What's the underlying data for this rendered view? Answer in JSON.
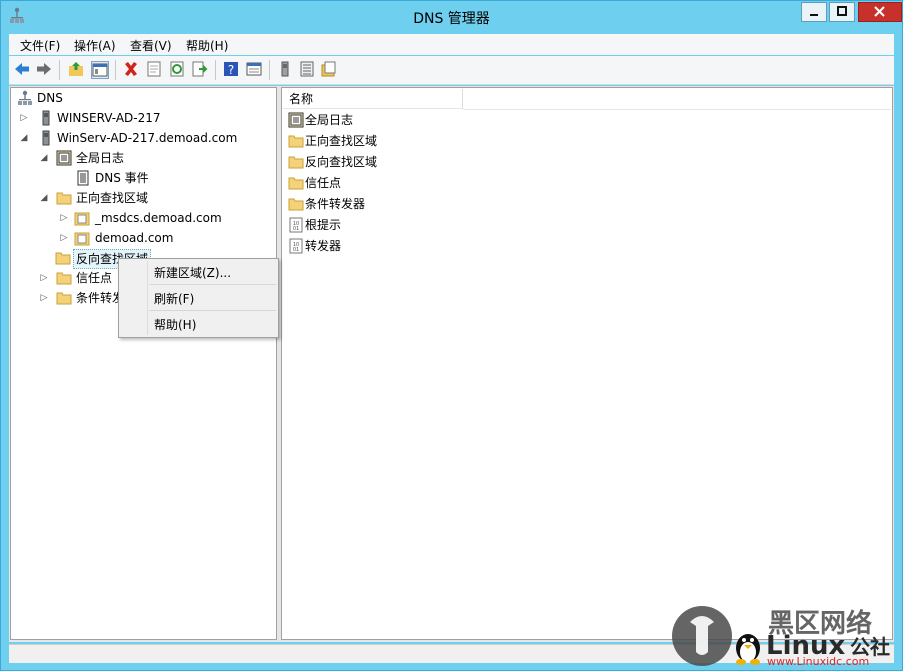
{
  "window": {
    "title": "DNS 管理器"
  },
  "menubar": {
    "items": [
      "文件(F)",
      "操作(A)",
      "查看(V)",
      "帮助(H)"
    ]
  },
  "toolbar": {
    "buttons": [
      "back-arrow-icon",
      "forward-arrow-icon",
      "up-folder-icon",
      "show-hide-tree-icon",
      "delete-icon",
      "properties-icon",
      "refresh-icon",
      "export-icon",
      "help-icon",
      "view-icon",
      "server-icon",
      "list-icon",
      "zones-icon"
    ]
  },
  "tree": {
    "root": "DNS",
    "servers": [
      {
        "label": "WINSERV-AD-217"
      },
      {
        "label": "WinServ-AD-217.demoad.com"
      }
    ],
    "global_logs": "全局日志",
    "dns_events": "DNS 事件",
    "forward_zones": "正向查找区域",
    "msdcs": "_msdcs.demoad.com",
    "demoad": "demoad.com",
    "reverse_zones": "反向查找区域",
    "trust_points": "信任点",
    "conditional_forwarders": "条件转发器"
  },
  "list": {
    "column_name": "名称",
    "items": [
      "全局日志",
      "正向查找区域",
      "反向查找区域",
      "信任点",
      "条件转发器",
      "根提示",
      "转发器"
    ]
  },
  "context_menu": {
    "items": [
      "新建区域(Z)...",
      "刷新(F)",
      "帮助(H)"
    ]
  },
  "watermark": {
    "brand": "黑区网络",
    "logo": "Linux公社",
    "url": "www.Linuxidc.com"
  },
  "colors": {
    "titlebar": "#6fcfee",
    "close_button": "#c7312b",
    "folder": "#f5d27a"
  }
}
